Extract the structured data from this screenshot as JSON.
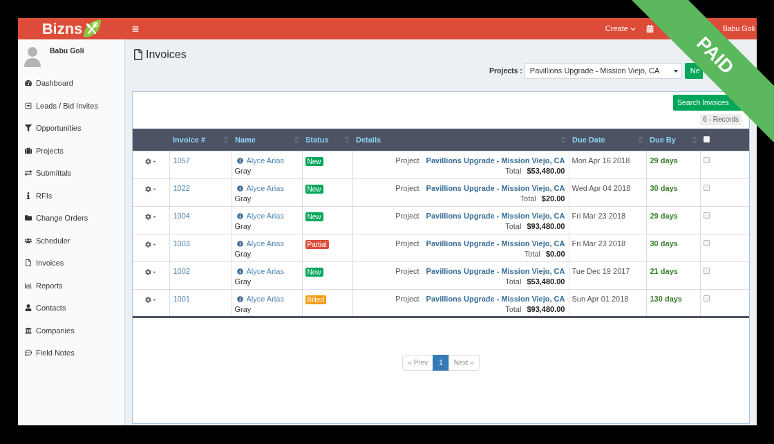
{
  "header": {
    "logo": "Bizns",
    "create": "Create",
    "user": "Babu Goli"
  },
  "sidebar": {
    "user": "Babu Goli",
    "items": [
      "Dashboard",
      "Leads / Bid Invites",
      "Opportunities",
      "Projects",
      "Submittals",
      "RFIs",
      "Change Orders",
      "Scheduler",
      "Invoices",
      "Reports",
      "Contacts",
      "Companies",
      "Field Notes"
    ]
  },
  "page": {
    "title": "Invoices",
    "project_label": "Projects :",
    "project": "Pavillions Upgrade - Mission Viejo, CA",
    "new_button": "Ne"
  },
  "panel": {
    "search_button": "Search Invoices",
    "records": "6 - Records"
  },
  "table": {
    "select_all": {
      "checked": false
    },
    "columns": [
      {
        "label": "Invoice #",
        "sortable": true
      },
      {
        "label": "Name",
        "sortable": true
      },
      {
        "label": "Status",
        "sortable": true
      },
      {
        "label": "Details",
        "sortable": true
      },
      {
        "label": "Due Date",
        "sortable": true
      },
      {
        "label": "Due By",
        "sortable": true
      }
    ],
    "rows": [
      {
        "invoice": "1057",
        "name": "Alyce Arias",
        "name_line_2": "Gray",
        "status": {
          "label": "New",
          "color": "#00a65a"
        },
        "detail_label": "Project",
        "project": "Pavillions Upgrade - Mission Viejo, CA",
        "total_label": "Total",
        "total": "$53,480.00",
        "due_date": "Mon Apr 16 2018",
        "due_by": "29 days",
        "checked": false
      },
      {
        "invoice": "1022",
        "name": "Alyce Arias",
        "name_line_2": "Gray",
        "status": {
          "label": "New",
          "color": "#00a65a"
        },
        "detail_label": "Project",
        "project": "Pavillions Upgrade - Mission Viejo, CA",
        "total_label": "Total",
        "total": "$20.00",
        "due_date": "Wed Apr 04 2018",
        "due_by": "30 days",
        "checked": false
      },
      {
        "invoice": "1004",
        "name": "Alyce Arias",
        "name_line_2": "Gray",
        "status": {
          "label": "New",
          "color": "#00a65a"
        },
        "detail_label": "Project",
        "project": "Pavillions Upgrade - Mission Viejo, CA",
        "total_label": "Total",
        "total": "$93,480.00",
        "due_date": "Fri Mar 23 2018",
        "due_by": "29 days",
        "checked": false
      },
      {
        "invoice": "1003",
        "name": "Alyce Arias",
        "name_line_2": "Gray",
        "status": {
          "label": "Partial",
          "color": "#dd4b39"
        },
        "detail_label": "Project",
        "project": "Pavillions Upgrade - Mission Viejo, CA",
        "total_label": "Total",
        "total": "$0.00",
        "due_date": "Fri Mar 23 2018",
        "due_by": "30 days",
        "checked": false
      },
      {
        "invoice": "1002",
        "name": "Alyce Arias",
        "name_line_2": "Gray",
        "status": {
          "label": "New",
          "color": "#00a65a"
        },
        "detail_label": "Project",
        "project": "Pavillions Upgrade - Mission Viejo, CA",
        "total_label": "Total",
        "total": "$53,480.00",
        "due_date": "Tue Dec 19 2017",
        "due_by": "21 days",
        "checked": false
      },
      {
        "invoice": "1001",
        "name": "Alyce Arias",
        "name_line_2": "Gray",
        "status": {
          "label": "Billed",
          "color": "#f39c12"
        },
        "detail_label": "Project",
        "project": "Pavillions Upgrade - Mission Viejo, CA",
        "total_label": "Total",
        "total": "$93,480.00",
        "due_date": "Sun Apr 01 2018",
        "due_by": "130 days",
        "checked": false
      }
    ]
  },
  "pagination": {
    "prev": {
      "label": "« Prev",
      "disabled": true
    },
    "pages": [
      {
        "label": "1",
        "selected": true
      }
    ],
    "next": {
      "label": "Next »",
      "disabled": true
    }
  },
  "ribbon": {
    "text": "PAID"
  }
}
